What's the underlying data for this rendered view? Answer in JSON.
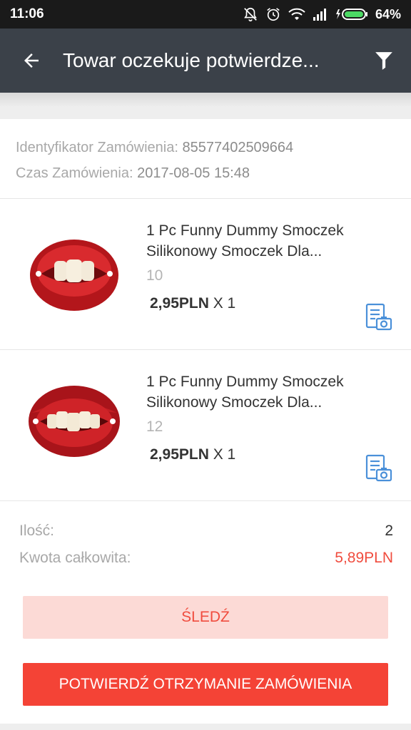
{
  "status_bar": {
    "time": "11:06",
    "battery": "64%"
  },
  "header": {
    "title": "Towar oczekuje potwierdze..."
  },
  "order": {
    "id_label": "Identyfikator Zamówienia:",
    "id_value": "85577402509664",
    "time_label": "Czas Zamówienia:",
    "time_value": "2017-08-05 15:48"
  },
  "items": [
    {
      "name_line1": "1 Pc Funny Dummy Smoczek",
      "name_line2": "Silikonowy Smoczek Dla...",
      "variant": "10",
      "price": "2,95PLN",
      "qty": "X 1"
    },
    {
      "name_line1": "1 Pc Funny Dummy Smoczek",
      "name_line2": "Silikonowy Smoczek Dla...",
      "variant": "12",
      "price": "2,95PLN",
      "qty": "X 1"
    }
  ],
  "summary": {
    "qty_label": "Ilość:",
    "qty_value": "2",
    "total_label": "Kwota całkowita:",
    "total_value": "5,89PLN"
  },
  "buttons": {
    "track": "ŚLEDŹ",
    "confirm": "POTWIERDŹ OTRZYMANIE ZAMÓWIENIA"
  },
  "colors": {
    "app_bar": "#3b4149",
    "accent": "#f44336",
    "track_bg": "#fcdad6",
    "icon_blue": "#4a90d9"
  }
}
